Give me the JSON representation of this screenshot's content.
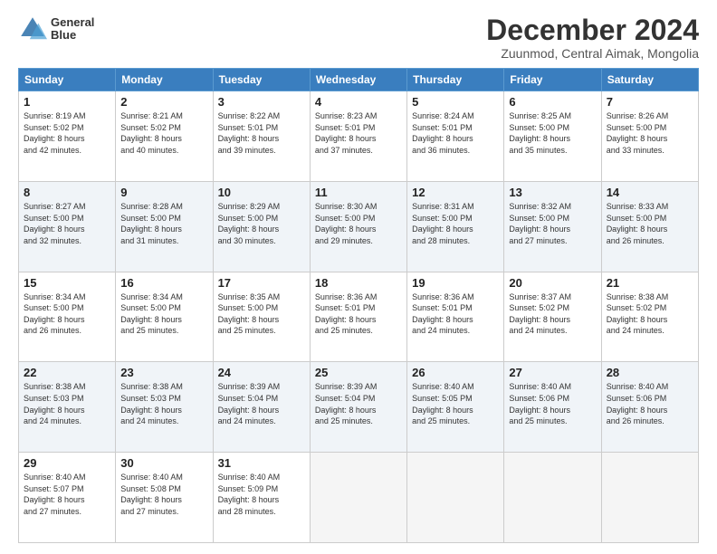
{
  "logo": {
    "line1": "General",
    "line2": "Blue"
  },
  "title": "December 2024",
  "location": "Zuunmod, Central Aimak, Mongolia",
  "headers": [
    "Sunday",
    "Monday",
    "Tuesday",
    "Wednesday",
    "Thursday",
    "Friday",
    "Saturday"
  ],
  "weeks": [
    [
      {
        "day": "1",
        "info": "Sunrise: 8:19 AM\nSunset: 5:02 PM\nDaylight: 8 hours\nand 42 minutes."
      },
      {
        "day": "2",
        "info": "Sunrise: 8:21 AM\nSunset: 5:02 PM\nDaylight: 8 hours\nand 40 minutes."
      },
      {
        "day": "3",
        "info": "Sunrise: 8:22 AM\nSunset: 5:01 PM\nDaylight: 8 hours\nand 39 minutes."
      },
      {
        "day": "4",
        "info": "Sunrise: 8:23 AM\nSunset: 5:01 PM\nDaylight: 8 hours\nand 37 minutes."
      },
      {
        "day": "5",
        "info": "Sunrise: 8:24 AM\nSunset: 5:01 PM\nDaylight: 8 hours\nand 36 minutes."
      },
      {
        "day": "6",
        "info": "Sunrise: 8:25 AM\nSunset: 5:00 PM\nDaylight: 8 hours\nand 35 minutes."
      },
      {
        "day": "7",
        "info": "Sunrise: 8:26 AM\nSunset: 5:00 PM\nDaylight: 8 hours\nand 33 minutes."
      }
    ],
    [
      {
        "day": "8",
        "info": "Sunrise: 8:27 AM\nSunset: 5:00 PM\nDaylight: 8 hours\nand 32 minutes."
      },
      {
        "day": "9",
        "info": "Sunrise: 8:28 AM\nSunset: 5:00 PM\nDaylight: 8 hours\nand 31 minutes."
      },
      {
        "day": "10",
        "info": "Sunrise: 8:29 AM\nSunset: 5:00 PM\nDaylight: 8 hours\nand 30 minutes."
      },
      {
        "day": "11",
        "info": "Sunrise: 8:30 AM\nSunset: 5:00 PM\nDaylight: 8 hours\nand 29 minutes."
      },
      {
        "day": "12",
        "info": "Sunrise: 8:31 AM\nSunset: 5:00 PM\nDaylight: 8 hours\nand 28 minutes."
      },
      {
        "day": "13",
        "info": "Sunrise: 8:32 AM\nSunset: 5:00 PM\nDaylight: 8 hours\nand 27 minutes."
      },
      {
        "day": "14",
        "info": "Sunrise: 8:33 AM\nSunset: 5:00 PM\nDaylight: 8 hours\nand 26 minutes."
      }
    ],
    [
      {
        "day": "15",
        "info": "Sunrise: 8:34 AM\nSunset: 5:00 PM\nDaylight: 8 hours\nand 26 minutes."
      },
      {
        "day": "16",
        "info": "Sunrise: 8:34 AM\nSunset: 5:00 PM\nDaylight: 8 hours\nand 25 minutes."
      },
      {
        "day": "17",
        "info": "Sunrise: 8:35 AM\nSunset: 5:00 PM\nDaylight: 8 hours\nand 25 minutes."
      },
      {
        "day": "18",
        "info": "Sunrise: 8:36 AM\nSunset: 5:01 PM\nDaylight: 8 hours\nand 25 minutes."
      },
      {
        "day": "19",
        "info": "Sunrise: 8:36 AM\nSunset: 5:01 PM\nDaylight: 8 hours\nand 24 minutes."
      },
      {
        "day": "20",
        "info": "Sunrise: 8:37 AM\nSunset: 5:02 PM\nDaylight: 8 hours\nand 24 minutes."
      },
      {
        "day": "21",
        "info": "Sunrise: 8:38 AM\nSunset: 5:02 PM\nDaylight: 8 hours\nand 24 minutes."
      }
    ],
    [
      {
        "day": "22",
        "info": "Sunrise: 8:38 AM\nSunset: 5:03 PM\nDaylight: 8 hours\nand 24 minutes."
      },
      {
        "day": "23",
        "info": "Sunrise: 8:38 AM\nSunset: 5:03 PM\nDaylight: 8 hours\nand 24 minutes."
      },
      {
        "day": "24",
        "info": "Sunrise: 8:39 AM\nSunset: 5:04 PM\nDaylight: 8 hours\nand 24 minutes."
      },
      {
        "day": "25",
        "info": "Sunrise: 8:39 AM\nSunset: 5:04 PM\nDaylight: 8 hours\nand 25 minutes."
      },
      {
        "day": "26",
        "info": "Sunrise: 8:40 AM\nSunset: 5:05 PM\nDaylight: 8 hours\nand 25 minutes."
      },
      {
        "day": "27",
        "info": "Sunrise: 8:40 AM\nSunset: 5:06 PM\nDaylight: 8 hours\nand 25 minutes."
      },
      {
        "day": "28",
        "info": "Sunrise: 8:40 AM\nSunset: 5:06 PM\nDaylight: 8 hours\nand 26 minutes."
      }
    ],
    [
      {
        "day": "29",
        "info": "Sunrise: 8:40 AM\nSunset: 5:07 PM\nDaylight: 8 hours\nand 27 minutes."
      },
      {
        "day": "30",
        "info": "Sunrise: 8:40 AM\nSunset: 5:08 PM\nDaylight: 8 hours\nand 27 minutes."
      },
      {
        "day": "31",
        "info": "Sunrise: 8:40 AM\nSunset: 5:09 PM\nDaylight: 8 hours\nand 28 minutes."
      },
      null,
      null,
      null,
      null
    ]
  ]
}
